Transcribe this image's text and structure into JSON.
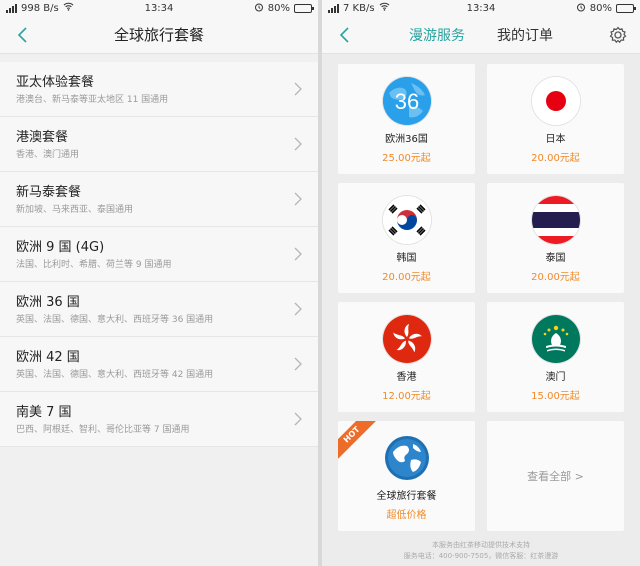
{
  "left": {
    "status": {
      "speed": "998 B/s",
      "time": "13:34",
      "battery": "80%",
      "battery_level": 0.8
    },
    "title": "全球旅行套餐",
    "items": [
      {
        "title": "亚太体验套餐",
        "subtitle": "港澳台、新马泰等亚太地区 11 国通用"
      },
      {
        "title": "港澳套餐",
        "subtitle": "香港、澳门通用"
      },
      {
        "title": "新马泰套餐",
        "subtitle": "新加坡、马来西亚、泰国通用"
      },
      {
        "title": "欧洲 9 国 (4G)",
        "subtitle": "法国、比利时、希腊、荷兰等 9 国通用"
      },
      {
        "title": "欧洲 36 国",
        "subtitle": "英国、法国、德国、意大利、西班牙等 36 国通用"
      },
      {
        "title": "欧洲 42 国",
        "subtitle": "英国、法国、德国、意大利、西班牙等 42 国通用"
      },
      {
        "title": "南美 7 国",
        "subtitle": "巴西、阿根廷、智利、哥伦比亚等 7 国通用"
      }
    ]
  },
  "right": {
    "status": {
      "speed": "7 KB/s",
      "time": "13:34",
      "battery": "80%",
      "battery_level": 0.8
    },
    "tabs": [
      {
        "label": "漫游服务",
        "active": true
      },
      {
        "label": "我的订单",
        "active": false
      }
    ],
    "cards": [
      {
        "id": "eu36",
        "name": "欧洲36国",
        "price": "25.00元起",
        "badge": "36",
        "icon": "europe-36-icon"
      },
      {
        "id": "japan",
        "name": "日本",
        "price": "20.00元起",
        "icon": "japan-flag-icon"
      },
      {
        "id": "korea",
        "name": "韩国",
        "price": "20.00元起",
        "icon": "korea-flag-icon"
      },
      {
        "id": "thailand",
        "name": "泰国",
        "price": "20.00元起",
        "icon": "thailand-flag-icon"
      },
      {
        "id": "hongkong",
        "name": "香港",
        "price": "12.00元起",
        "icon": "hongkong-flag-icon"
      },
      {
        "id": "macau",
        "name": "澳门",
        "price": "15.00元起",
        "icon": "macau-flag-icon"
      },
      {
        "id": "global",
        "name": "全球旅行套餐",
        "price": "超低价格",
        "hot": "HOT",
        "icon": "globe-icon"
      }
    ],
    "view_all": "查看全部 >",
    "footer_line1": "本服务由红茶移动提供技术支持",
    "footer_line2": "服务电话：400-900-7505，微信客服：红茶漫游"
  },
  "colors": {
    "accent": "#2aa3a0",
    "price": "#f08a2a",
    "hot": "#ee6c2a"
  }
}
